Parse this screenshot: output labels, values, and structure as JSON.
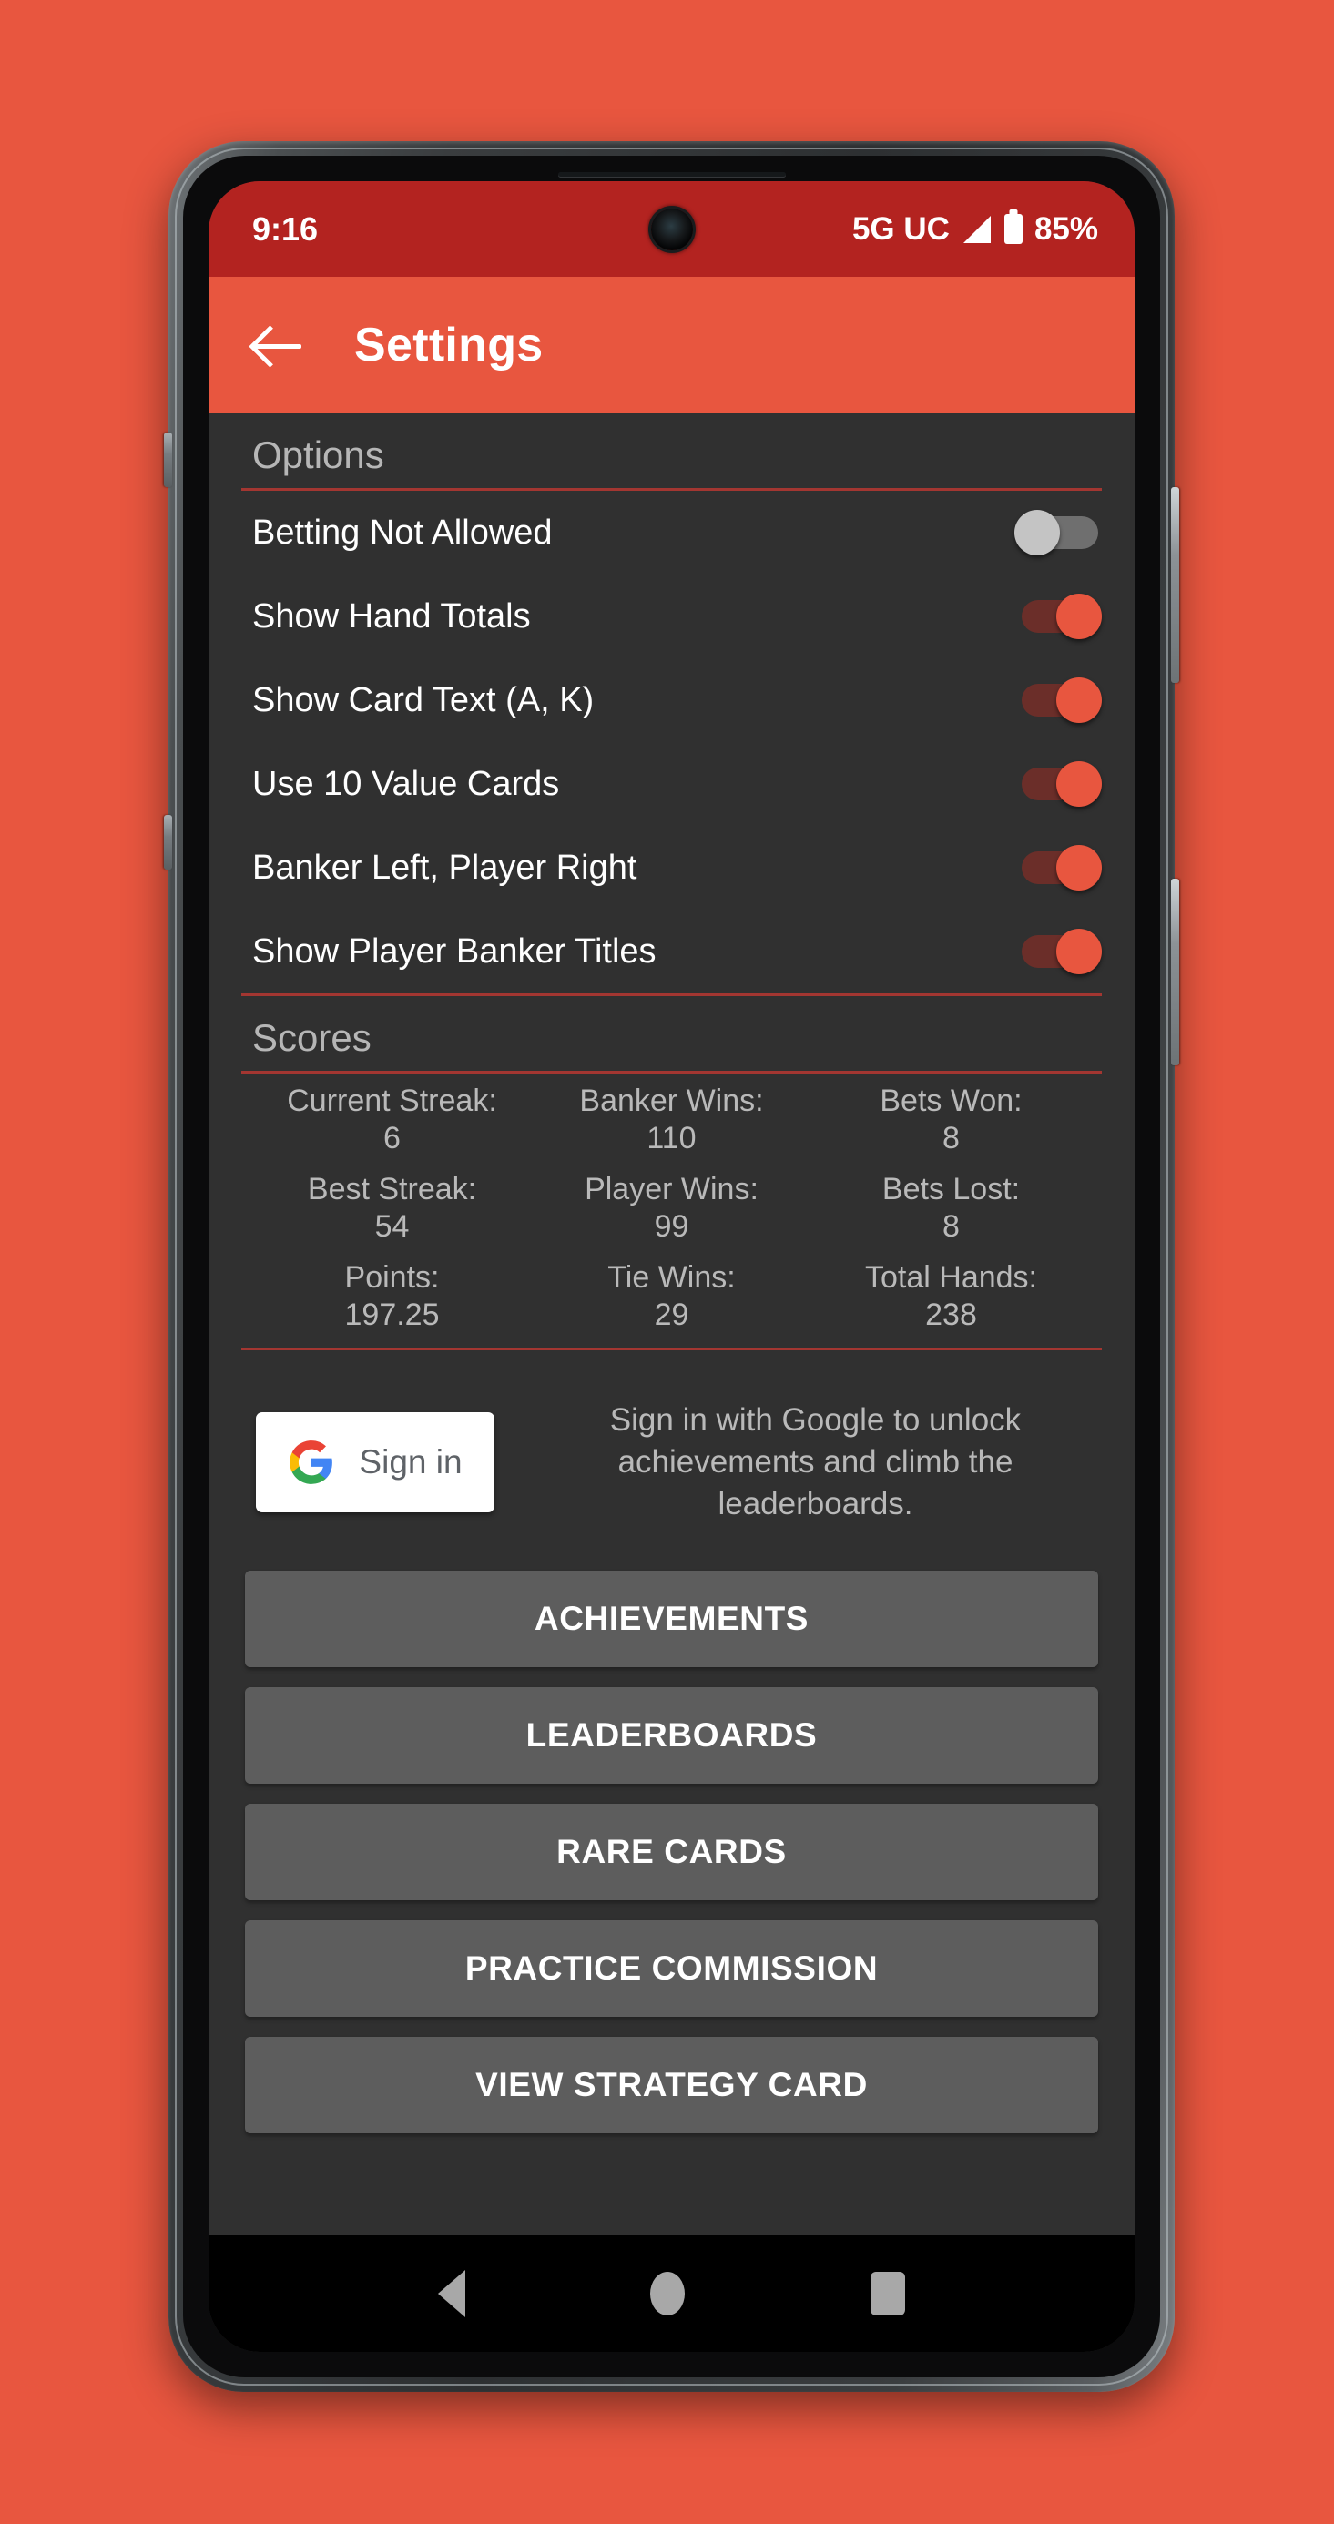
{
  "status_bar": {
    "time": "9:16",
    "network": "5G UC",
    "battery_percent": "85%",
    "signal_icon": "signal-triangle-icon",
    "battery_icon": "battery-icon"
  },
  "app_bar": {
    "back_icon": "back-arrow-icon",
    "title": "Settings"
  },
  "options": {
    "heading": "Options",
    "items": [
      {
        "label": "Betting Not Allowed",
        "state": "off"
      },
      {
        "label": "Show Hand Totals",
        "state": "on"
      },
      {
        "label": "Show Card Text (A, K)",
        "state": "on"
      },
      {
        "label": "Use 10 Value Cards",
        "state": "on"
      },
      {
        "label": "Banker Left, Player Right",
        "state": "on"
      },
      {
        "label": "Show Player Banker Titles",
        "state": "on"
      }
    ]
  },
  "scores": {
    "heading": "Scores",
    "cells": [
      {
        "key": "Current Streak:",
        "value": "6"
      },
      {
        "key": "Banker Wins:",
        "value": "110"
      },
      {
        "key": "Bets Won:",
        "value": "8"
      },
      {
        "key": "Best Streak:",
        "value": "54"
      },
      {
        "key": "Player Wins:",
        "value": "99"
      },
      {
        "key": "Bets Lost:",
        "value": "8"
      },
      {
        "key": "Points:",
        "value": "197.25"
      },
      {
        "key": "Tie Wins:",
        "value": "29"
      },
      {
        "key": "Total Hands:",
        "value": "238"
      }
    ]
  },
  "signin": {
    "button_label": "Sign in",
    "google_icon": "google-g-icon",
    "description": "Sign in with Google to unlock achievements and climb the leaderboards."
  },
  "buttons": [
    {
      "label": "ACHIEVEMENTS"
    },
    {
      "label": "LEADERBOARDS"
    },
    {
      "label": "RARE CARDS"
    },
    {
      "label": "PRACTICE COMMISSION"
    },
    {
      "label": "VIEW STRATEGY CARD"
    }
  ],
  "nav_bar": {
    "back_icon": "nav-back-icon",
    "home_icon": "nav-home-icon",
    "recents_icon": "nav-recents-icon"
  },
  "colors": {
    "accent": "#e8563f",
    "status_bar": "#b32320",
    "screen_bg": "#303030",
    "divider": "#a33631",
    "button_bg": "#5d5d5d"
  }
}
